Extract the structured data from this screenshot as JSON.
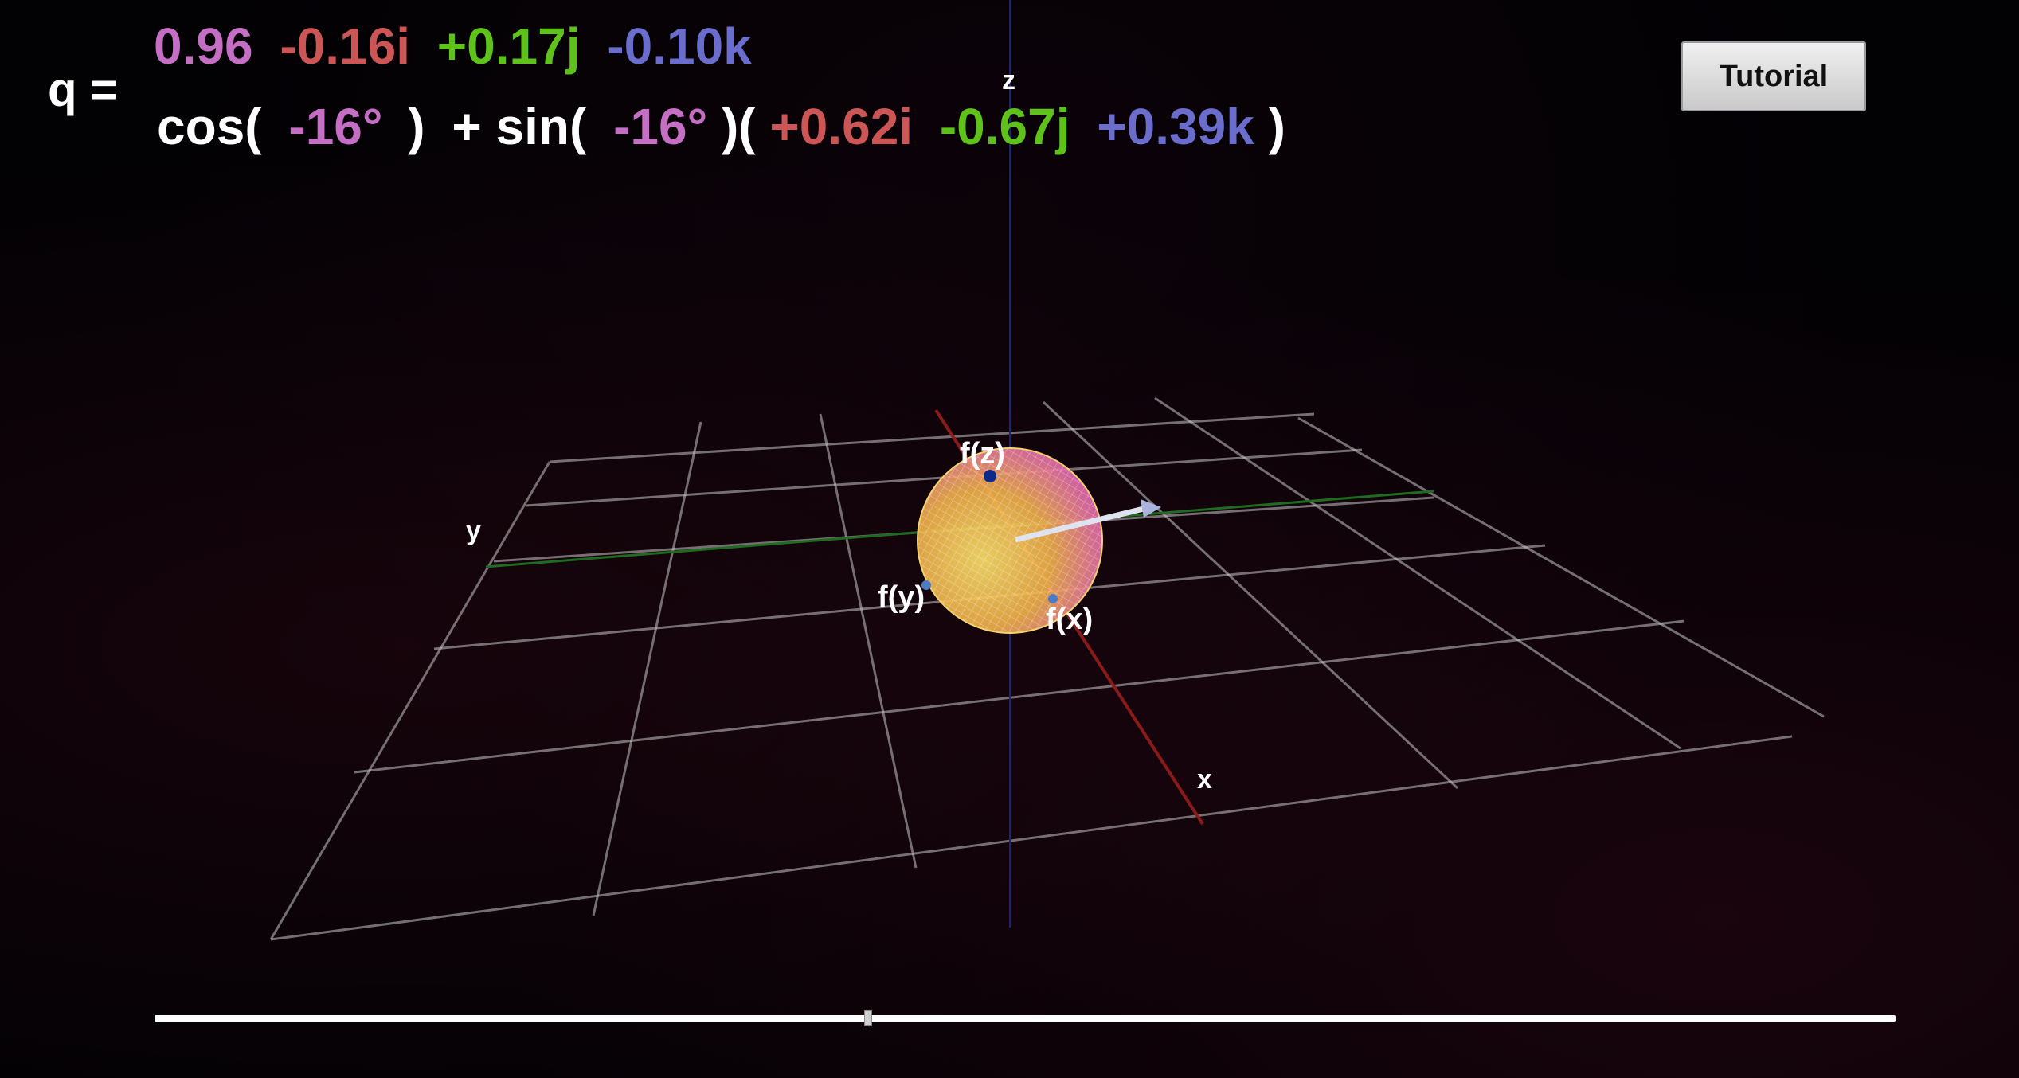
{
  "quaternion": {
    "prefix": "q =",
    "components": [
      {
        "text": "0.96",
        "color": "#c46fc4"
      },
      {
        "text": "-0.16i",
        "color": "#cc5555"
      },
      {
        "text": "+0.17j",
        "color": "#5fc21a"
      },
      {
        "text": "-0.10k",
        "color": "#6a6dcc"
      }
    ],
    "polar": {
      "cos_text": "cos(",
      "angle1": "-16°",
      "close1": ")",
      "plus_sin": "+ sin(",
      "angle2": "-16°",
      "close2": ")(",
      "axis_i": "+0.62i",
      "axis_j": "-0.67j",
      "axis_k": "+0.39k",
      "close3": ")",
      "text_color": "#ffffff",
      "angle_color": "#c46fc4"
    }
  },
  "toolbar": {
    "tutorial_label": "Tutorial"
  },
  "scene": {
    "axis_labels": {
      "x": "x",
      "y": "y",
      "z": "z"
    },
    "point_labels": {
      "fx": "f(x)",
      "fy": "f(y)",
      "fz": "f(z)"
    },
    "colors": {
      "x_axis": "#8b1a1a",
      "y_axis": "#1f6b1f",
      "z_axis": "#1a237e",
      "sphere_warm": "#f5c542",
      "sphere_pink": "#e85ad0",
      "arrow": "#dfe3f0"
    }
  },
  "slider": {
    "value_fraction": 0.41
  }
}
